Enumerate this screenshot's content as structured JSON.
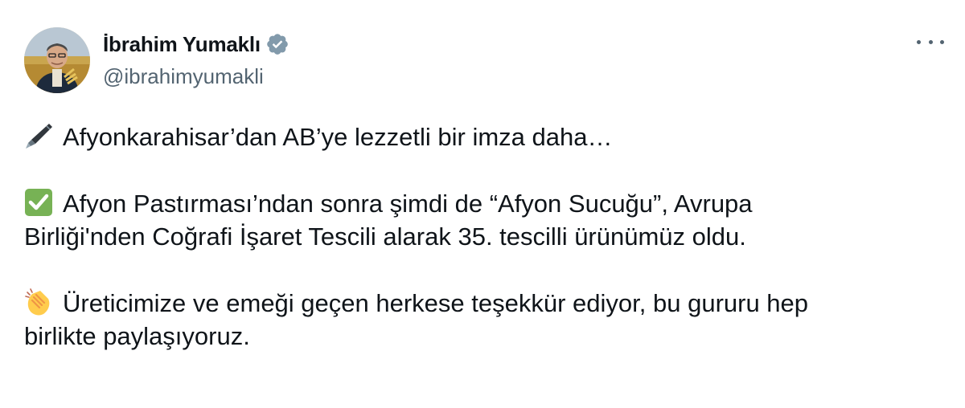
{
  "author": {
    "display_name": "İbrahim Yumaklı",
    "handle": "@ibrahimyumakli",
    "verified_color": "#829aab"
  },
  "menu": {
    "more_icon": "more-horizontal-icon"
  },
  "tweet": {
    "line1": "Afyonkarahisar’dan AB’ye lezzetli bir imza daha…",
    "line2a": "Afyon Pastırması’ndan sonra şimdi de “Afyon Sucuğu”, Avrupa",
    "line2b": "Birliği'nden Coğrafi İşaret Tescili alarak 35. tescilli ürünümüz oldu.",
    "line3a": "Üreticimize ve emeği geçen herkese teşekkür ediyor, bu gururu hep",
    "line3b": "birlikte paylaşıyoruz.",
    "emojis": [
      "fountain-pen-icon",
      "check-mark-button-icon",
      "clapping-hands-icon"
    ]
  }
}
